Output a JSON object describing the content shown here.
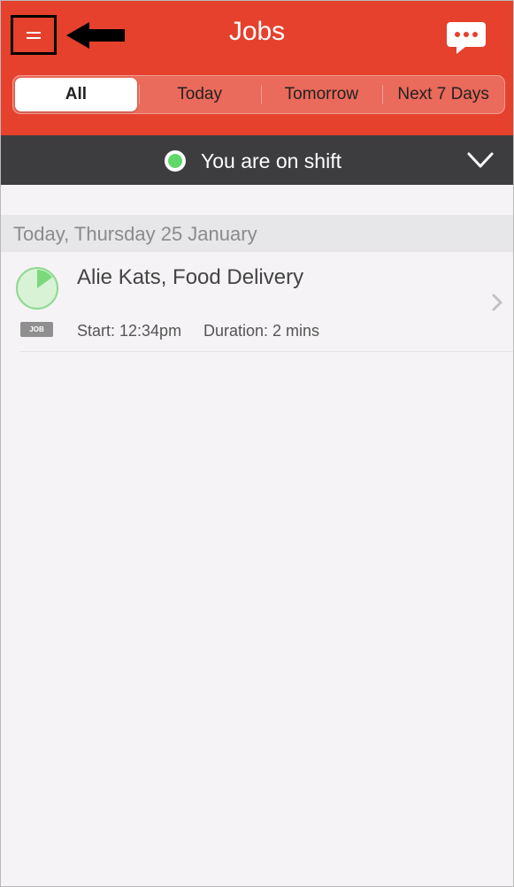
{
  "header": {
    "title": "Jobs",
    "menu_icon": "hamburger-menu-icon",
    "chat_icon": "chat-bubble-icon",
    "annotation_icon": "left-arrow-icon",
    "background_color": "#e5412d"
  },
  "segments": [
    {
      "label": "All",
      "active": true
    },
    {
      "label": "Today",
      "active": false
    },
    {
      "label": "Tomorrow",
      "active": false
    },
    {
      "label": "Next 7 Days",
      "active": false
    }
  ],
  "shift": {
    "status_text": "You are on shift",
    "status_color": "#5fd86a",
    "chevron_icon": "chevron-down-icon"
  },
  "section": {
    "label": "Today, Thursday 25 January"
  },
  "jobs": [
    {
      "title": "Alie Kats, Food Delivery",
      "badge": "JOB",
      "start": "Start: 12:34pm",
      "duration": "Duration: 2 mins",
      "progress": 0.15
    }
  ]
}
